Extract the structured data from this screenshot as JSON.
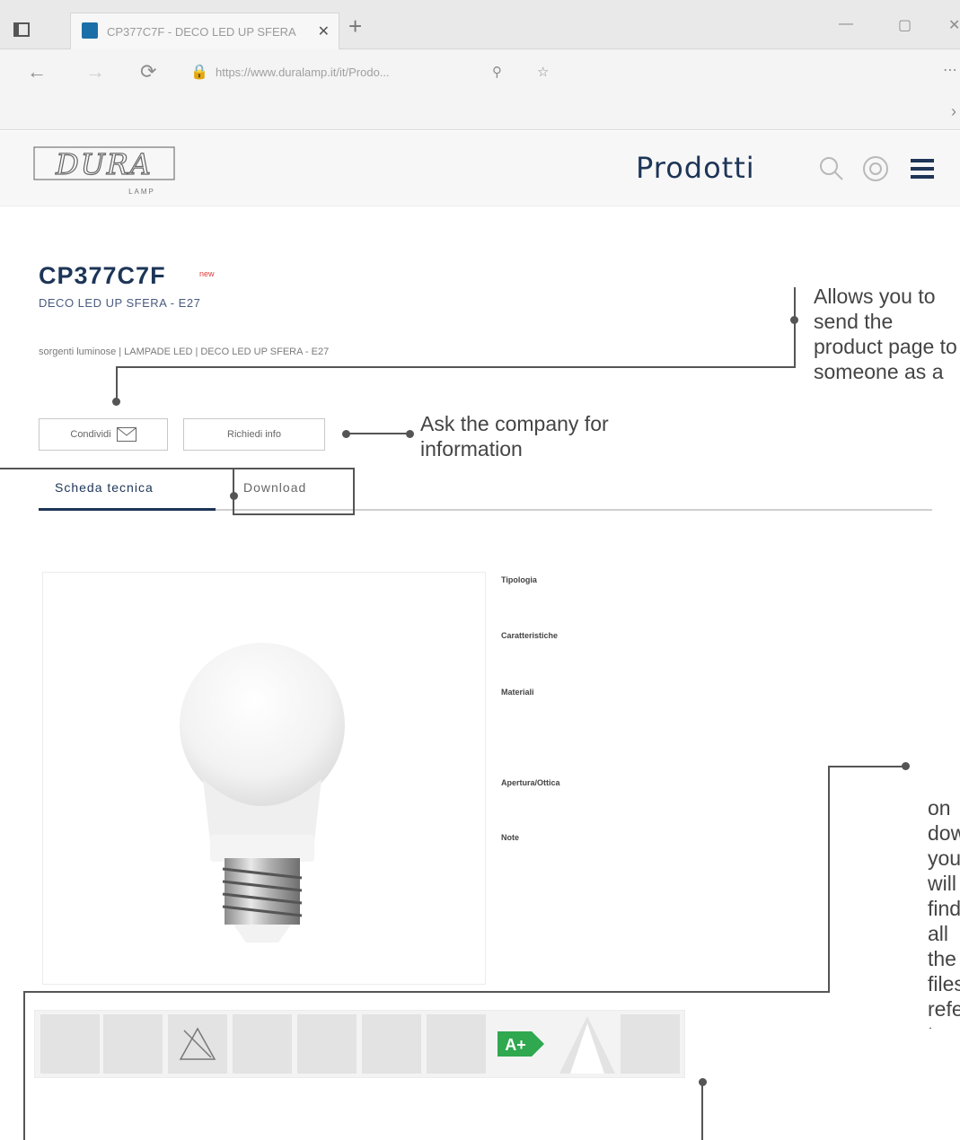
{
  "browser": {
    "tab_title": "CP377C7F - DECO LED UP SFERA",
    "url": "https://www.duralamp.it/it/Prodo..."
  },
  "header": {
    "logo_text": "DURA",
    "logo_sub": "LAMP",
    "nav_title": "Prodotti"
  },
  "product": {
    "code": "CP377C7F",
    "new_tag": "new",
    "name": "DECO LED UP SFERA - E27",
    "breadcrumb": "sorgenti luminose | LAMPADE LED | DECO LED UP SFERA - E27",
    "share_label": "Condividi",
    "info_label": "Richiedi info"
  },
  "tabs": [
    {
      "label": "Scheda tecnica",
      "active": true
    },
    {
      "label": "Download",
      "active": false
    }
  ],
  "specs": [
    {
      "title": "Tipologia",
      "text": ""
    },
    {
      "title": "Caratteristiche",
      "text": ""
    },
    {
      "title": "Materiali",
      "text": ""
    },
    {
      "title": "Apertura/Ottica",
      "text": ""
    },
    {
      "title": "Note",
      "text": ""
    }
  ],
  "feature_icons": [
    "",
    "",
    "",
    "",
    "",
    "",
    "",
    "",
    "",
    ""
  ],
  "energy_class": "A+",
  "annotations": {
    "share_note": "Allows you to send the product page to someone as a link; sending it to yourself is weightless, allowing you to use the email as a reminder",
    "info_note": "Ask the company for information",
    "tabs_note": "on download you will find all the files referring to the product. An icon shelf allows you to see information at a glance."
  },
  "colors": {
    "brand": "#1d3557",
    "energy_green": "#2fa84f"
  }
}
